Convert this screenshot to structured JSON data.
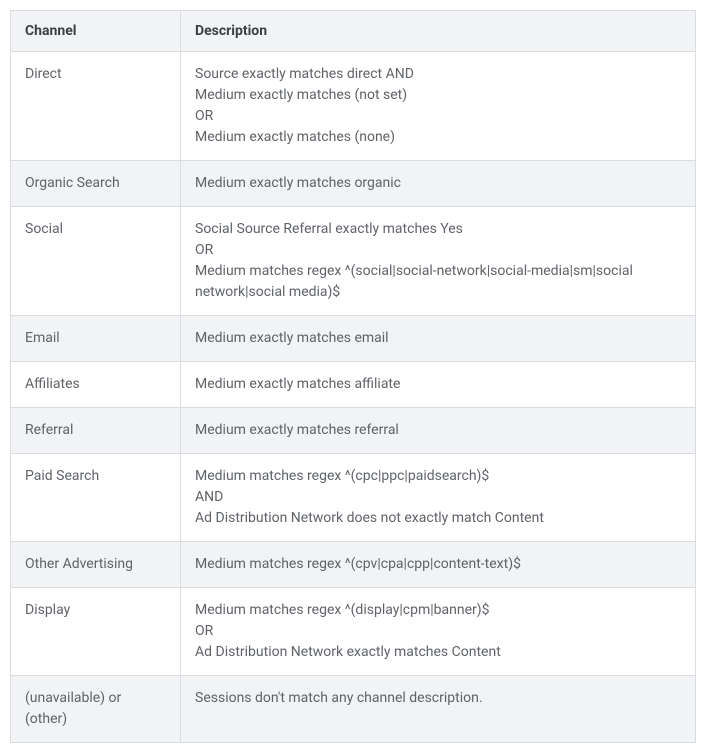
{
  "table": {
    "headers": {
      "channel": "Channel",
      "description": "Description"
    },
    "rows": [
      {
        "channel": "Direct",
        "description_lines": [
          "Source exactly matches direct AND",
          "Medium exactly matches (not set)",
          "OR",
          "Medium exactly matches (none)"
        ]
      },
      {
        "channel": "Organic Search",
        "description_lines": [
          "Medium exactly matches organic"
        ]
      },
      {
        "channel": "Social",
        "description_lines": [
          "Social Source Referral exactly matches Yes",
          "OR",
          "Medium matches regex ^(social|social-network|social-media|sm|social network|social media)$"
        ]
      },
      {
        "channel": "Email",
        "description_lines": [
          "Medium exactly matches email"
        ]
      },
      {
        "channel": "Affiliates",
        "description_lines": [
          "Medium exactly matches affiliate"
        ]
      },
      {
        "channel": "Referral",
        "description_lines": [
          "Medium exactly matches referral"
        ]
      },
      {
        "channel": "Paid Search",
        "description_lines": [
          "Medium matches regex ^(cpc|ppc|paidsearch)$",
          "AND",
          "Ad Distribution Network does not exactly match Content"
        ]
      },
      {
        "channel": "Other Advertising",
        "description_lines": [
          "Medium matches regex ^(cpv|cpa|cpp|content-text)$"
        ]
      },
      {
        "channel": "Display",
        "description_lines": [
          "Medium matches regex ^(display|cpm|banner)$",
          "OR",
          "Ad Distribution Network exactly matches Content"
        ]
      },
      {
        "channel": "(unavailable) or (other)",
        "description_lines": [
          "Sessions don't match any channel description."
        ]
      }
    ]
  }
}
